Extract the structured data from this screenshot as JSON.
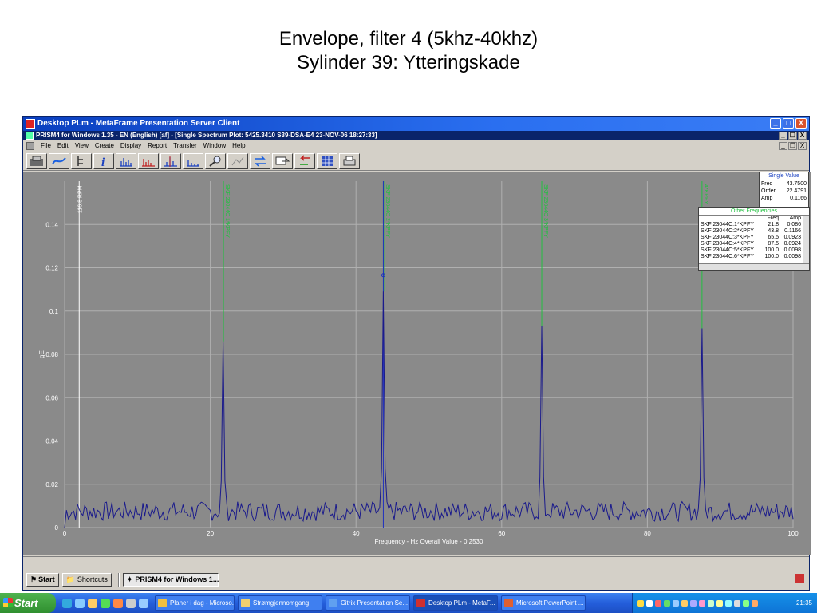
{
  "slide": {
    "title_line1": "Envelope, filter 4 (5khz-40khz)",
    "title_line2": "Sylinder 39: Ytteringskade"
  },
  "outer_window": {
    "title": "Desktop PLm - MetaFrame Presentation Server Client",
    "controls": [
      "_",
      "□",
      "X"
    ]
  },
  "inner_window": {
    "title": "PRISM4 for Windows 1.35 - EN (English) [af] - [Single Spectrum Plot: 5425.3410 S39-DSA-E4 23-NOV-06 18:27:33]",
    "controls": [
      "_",
      "❐",
      "X"
    ]
  },
  "menu": {
    "items": [
      "File",
      "Edit",
      "View",
      "Create",
      "Display",
      "Report",
      "Transfer",
      "Window",
      "Help"
    ]
  },
  "toolbar": {
    "buttons": [
      "home-plot-icon",
      "trend-icon",
      "tree-icon",
      "info-icon",
      "spectrum-icon",
      "spectrum-red-icon",
      "cursor-spectrum-icon",
      "spectrum-blue-icon",
      "zoom-icon",
      "graph-icon",
      "swap-icon",
      "plot-compare-icon",
      "back-icon",
      "data-table-icon",
      "print-icon"
    ]
  },
  "single_value": {
    "header": "Single Value",
    "rows": [
      {
        "label": "Freq",
        "value": "43.7500"
      },
      {
        "label": "Order",
        "value": "22.4791"
      },
      {
        "label": "Amp",
        "value": "0.1166"
      }
    ]
  },
  "other_frequencies": {
    "header": "Other Frequencies",
    "columns": [
      "",
      "Freq",
      "Amp"
    ],
    "rows": [
      {
        "name": "SKF 23044C:1*KPFY",
        "freq": "21.8",
        "amp": "0.086"
      },
      {
        "name": "SKF 23044C:2*KPFY",
        "freq": "43.8",
        "amp": "0.1166"
      },
      {
        "name": "SKF 23044C:3*KPFY",
        "freq": "65.5",
        "amp": "0.0923"
      },
      {
        "name": "SKF 23044C:4*KPFY",
        "freq": "87.5",
        "amp": "0.0924"
      },
      {
        "name": "SKF 23044C:5*KPFY",
        "freq": "100.0",
        "amp": "0.0098"
      },
      {
        "name": "SKF 23044C:6*KPFY",
        "freq": "100.0",
        "amp": "0.0098"
      }
    ]
  },
  "chart_data": {
    "type": "line",
    "xlabel": "Frequency - Hz  Overall Value - 0.2530",
    "ylabel": "gE",
    "xlim": [
      0,
      100
    ],
    "ylim": [
      0,
      0.16
    ],
    "x_ticks": [
      "0",
      "20",
      "40",
      "60",
      "80",
      "100"
    ],
    "y_ticks": [
      "0",
      "0.02",
      "0.04",
      "0.06",
      "0.08",
      "0.1",
      "0.12",
      "0.14"
    ],
    "rpm_label": "116.8 RPM",
    "rpm_marker_x": 2.0,
    "cursor_x": 43.75,
    "cursor_amp": 0.1166,
    "fault_markers": [
      {
        "label": "SKF 23044C 1*KPFY",
        "x": 21.8
      },
      {
        "label": "SKF 23044C 2*KPFY",
        "x": 43.8
      },
      {
        "label": "SKF 23044C 3*KPFY",
        "x": 65.5
      },
      {
        "label": "4*KPFY",
        "x": 87.5
      }
    ],
    "peaks": [
      {
        "x": 21.8,
        "y": 0.086
      },
      {
        "x": 43.8,
        "y": 0.109
      },
      {
        "x": 65.5,
        "y": 0.093
      },
      {
        "x": 87.5,
        "y": 0.092
      }
    ],
    "noise_level": 0.012,
    "series": [
      {
        "name": "",
        "color": "#1a1a8c"
      }
    ],
    "grid": true
  },
  "inner_taskbar": {
    "start": "Start",
    "items": [
      "Shortcuts",
      "PRISM4 for Windows 1..."
    ]
  },
  "taskbar": {
    "start": "Start",
    "tasks": [
      {
        "label": "Planer i dag - Microso...",
        "icon_color": "#f0c040"
      },
      {
        "label": "Strømgjennomgang",
        "icon_color": "#f0d070"
      },
      {
        "label": "Citrix Presentation Se...",
        "icon_color": "#60a0f0"
      },
      {
        "label": "Desktop PLm - MetaF...",
        "icon_color": "#d03030"
      },
      {
        "label": "Microsoft PowerPoint ...",
        "icon_color": "#e06030"
      }
    ],
    "clock": "21:35"
  },
  "colors": {
    "plot_bg": "#8a8a8a",
    "grid": "#b0b0b0",
    "trace": "#1a1a8c",
    "marker": "#22c040",
    "axis_text": "#ffffff"
  }
}
